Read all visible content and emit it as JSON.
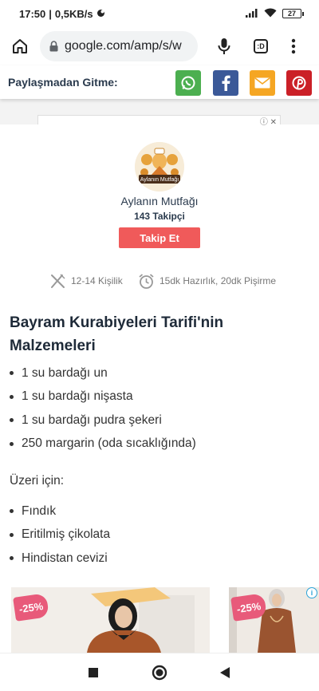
{
  "status_bar": {
    "time": "17:50",
    "network_speed": "0,5KB/s",
    "battery_level": "27",
    "icons": [
      "notification-icon",
      "signal-icon",
      "wifi-icon",
      "battery-icon"
    ]
  },
  "browser": {
    "url": "google.com/amp/s/w",
    "tab_count": ":D",
    "icons": [
      "home-icon",
      "lock-icon",
      "mic-icon",
      "tabs-icon",
      "menu-icon"
    ]
  },
  "share_bar": {
    "label": "Paylaşmadan Gitme:",
    "buttons": [
      {
        "name": "whatsapp",
        "color": "#4caf50"
      },
      {
        "name": "facebook",
        "color": "#3b5998"
      },
      {
        "name": "email",
        "color": "#f5a623"
      },
      {
        "name": "pinterest",
        "color": "#cb2027"
      }
    ]
  },
  "author": {
    "logo_text": "Aylanın Mutfağı",
    "name": "Aylanın Mutfağı",
    "followers": "143 Takipçi",
    "follow_label": "Takip Et"
  },
  "recipe_meta": {
    "servings": "12-14 Kişilik",
    "time": "15dk Hazırlık, 20dk Pişirme"
  },
  "ingredients": {
    "title": "Bayram Kurabiyeleri Tarifi'nin Malzemeleri",
    "main": [
      "1 su bardağı un",
      "1 su bardağı nişasta",
      "1 su bardağı pudra şekeri",
      "250 margarin (oda sıcaklığında)"
    ],
    "topping_heading": "Üzeri için:",
    "topping": [
      "Fındık",
      "Eritilmiş çikolata",
      "Hindistan cevizi"
    ]
  },
  "ad_products": [
    {
      "discount": "-25%"
    },
    {
      "discount": "-25%"
    }
  ],
  "ad_info_label": "i",
  "colors": {
    "follow_button": "#f05a5a",
    "discount_tag": "#e85a7a",
    "title_text": "#1e2a38"
  }
}
